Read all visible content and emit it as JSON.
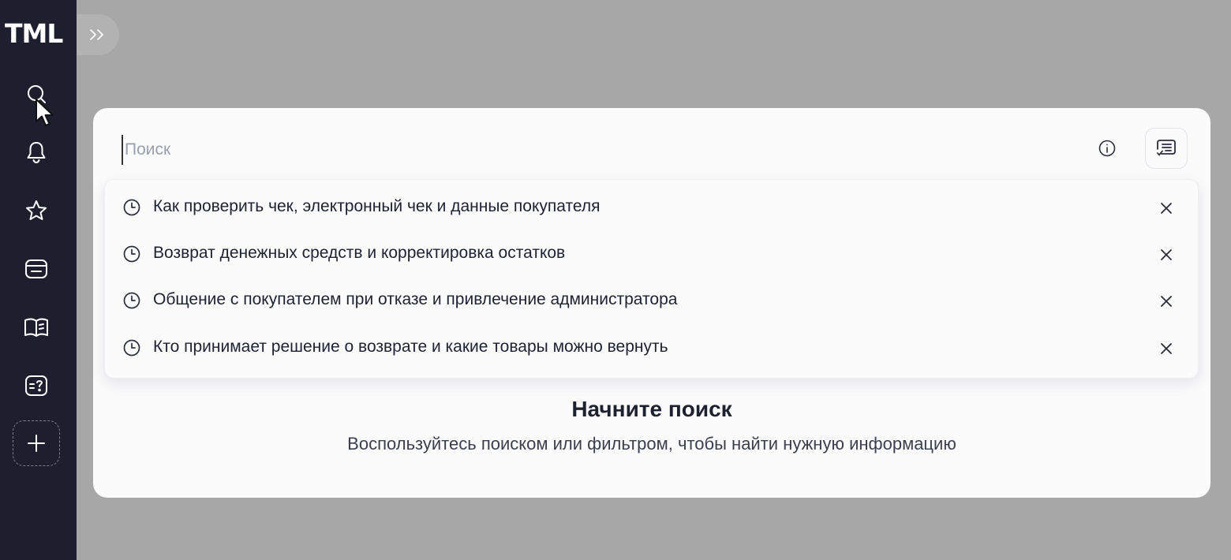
{
  "app": {
    "logo": "TML"
  },
  "sidebar": {
    "expand_icon": "double-chevron-right-icon",
    "items": [
      {
        "name": "search",
        "icon": "search-icon"
      },
      {
        "name": "notifications",
        "icon": "bell-icon"
      },
      {
        "name": "favorites",
        "icon": "star-icon"
      },
      {
        "name": "cards",
        "icon": "card-icon"
      },
      {
        "name": "knowledge",
        "icon": "book-icon"
      },
      {
        "name": "faq",
        "icon": "question-card-icon"
      },
      {
        "name": "add",
        "icon": "plus-icon"
      }
    ]
  },
  "search": {
    "placeholder": "Поиск",
    "value": "",
    "info_icon": "info-icon",
    "filter_icon": "filter-list-icon"
  },
  "history": [
    {
      "text": "Как проверить чек, электронный чек и данные покупателя"
    },
    {
      "text": "Возврат денежных средств и корректировка остатков"
    },
    {
      "text": "Общение с покупателем при отказе и привлечение администратора"
    },
    {
      "text": "Кто принимает решение о возврате и какие товары можно вернуть"
    }
  ],
  "empty_state": {
    "title": "Начните поиск",
    "subtitle": "Воспользуйтесь поиском или фильтром, чтобы найти нужную информацию"
  },
  "colors": {
    "sidebar": "#1d1f2e",
    "overlay": "#a7a7a7",
    "panel": "#fbfbfc",
    "text": "#1e2230"
  }
}
